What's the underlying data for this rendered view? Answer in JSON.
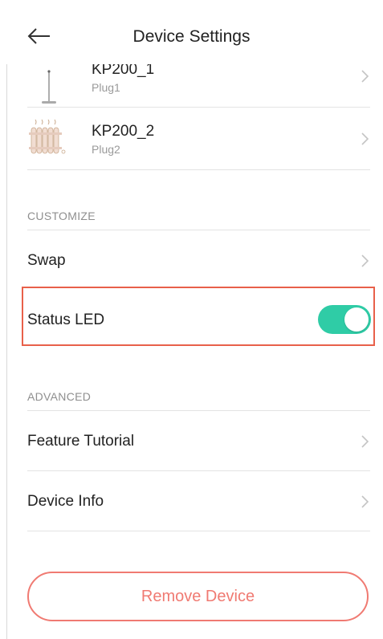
{
  "header": {
    "title": "Device Settings",
    "back_icon": "arrow-left-icon"
  },
  "devices": [
    {
      "name": "KP200_1",
      "sub": "Plug1",
      "icon": "floor-lamp-icon"
    },
    {
      "name": "KP200_2",
      "sub": "Plug2",
      "icon": "radiator-heater-icon"
    }
  ],
  "customize": {
    "label": "CUSTOMIZE",
    "swap_label": "Swap",
    "status_led_label": "Status LED",
    "status_led_on": true
  },
  "advanced": {
    "label": "ADVANCED",
    "feature_tutorial_label": "Feature Tutorial",
    "device_info_label": "Device Info"
  },
  "remove_button_label": "Remove Device",
  "colors": {
    "toggle_on": "#2fcca6",
    "remove_accent": "#f07a72",
    "highlight_border": "#e8604a"
  }
}
